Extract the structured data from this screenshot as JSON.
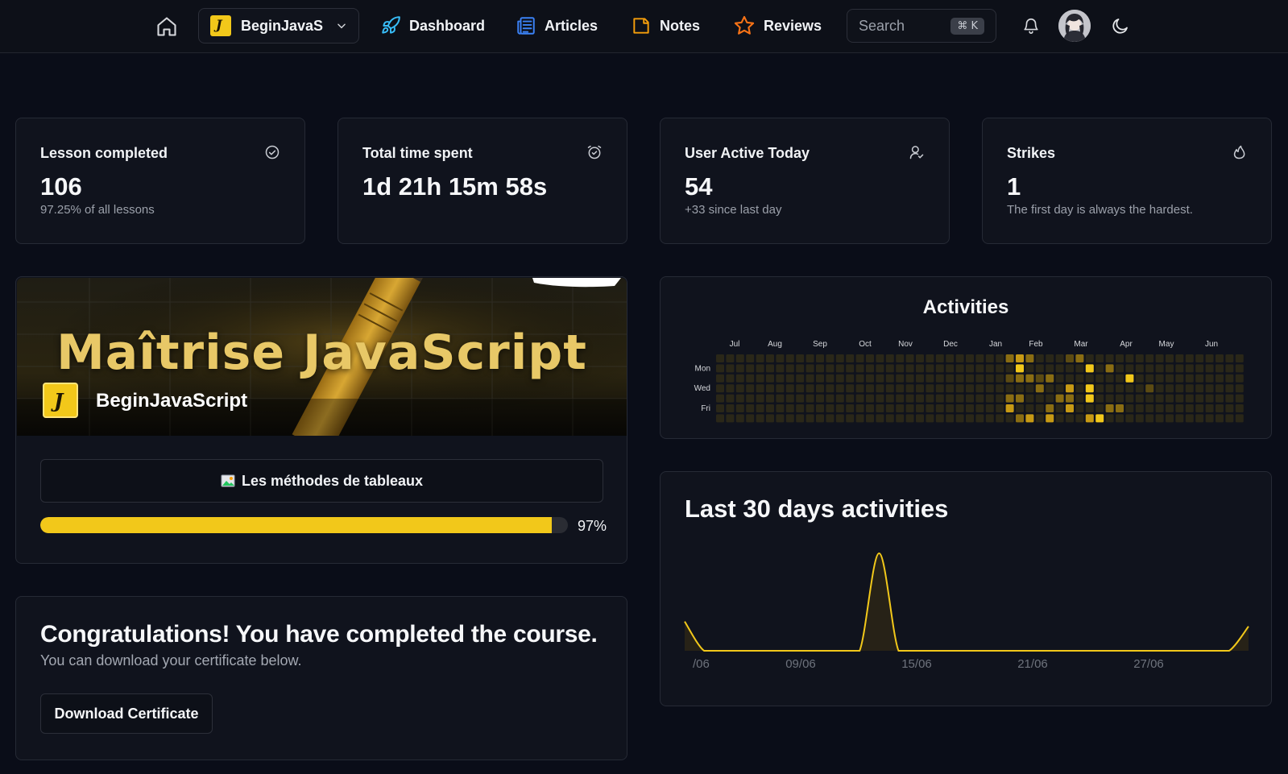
{
  "nav": {
    "course_selector": "BeginJavaS",
    "links": [
      {
        "label": "Dashboard",
        "icon": "rocket-icon",
        "color": "#38bdf8"
      },
      {
        "label": "Articles",
        "icon": "newspaper-icon",
        "color": "#3b82f6"
      },
      {
        "label": "Notes",
        "icon": "sticky-note-icon",
        "color": "#f59e0b"
      },
      {
        "label": "Reviews",
        "icon": "star-icon",
        "color": "#f97316"
      }
    ],
    "search_placeholder": "Search",
    "search_shortcut": "⌘ K"
  },
  "stats": [
    {
      "title": "Lesson completed",
      "value": "106",
      "sub": "97.25% of all lessons",
      "icon": "check-circle-icon"
    },
    {
      "title": "Total time spent",
      "value": "1d 21h 15m 58s",
      "sub": "",
      "icon": "alarm-clock-icon"
    },
    {
      "title": "User Active Today",
      "value": "54",
      "sub": "+33 since last day",
      "icon": "user-icon"
    },
    {
      "title": "Strikes",
      "value": "1",
      "sub": "The first day is always the hardest.",
      "icon": "flame-icon"
    }
  ],
  "course": {
    "banner_title": "Maîtrise JavaScript",
    "banner_name": "BeginJavaScript",
    "current_lesson": "Les méthodes de tableaux",
    "progress": 97,
    "progress_label": "97%"
  },
  "congrats": {
    "title": "Congratulations! You have completed the course.",
    "subtitle": "You can download your certificate below.",
    "button": "Download Certificate"
  },
  "colors": {
    "accent": "#f2c81a",
    "background": "#0a0d18",
    "card": "#10131d",
    "border": "#262a35"
  },
  "activities": {
    "title": "Activities",
    "months": [
      "Jul",
      "Aug",
      "Sep",
      "Oct",
      "Nov",
      "Dec",
      "Jan",
      "Feb",
      "Mar",
      "Apr",
      "May",
      "Jun"
    ],
    "days": [
      "Mon",
      "Wed",
      "Fri"
    ],
    "weeks": 53,
    "active_cells": [
      {
        "week": 29,
        "day": 0,
        "level": 2
      },
      {
        "week": 29,
        "day": 2,
        "level": 1
      },
      {
        "week": 29,
        "day": 4,
        "level": 2
      },
      {
        "week": 29,
        "day": 5,
        "level": 3
      },
      {
        "week": 30,
        "day": 0,
        "level": 3
      },
      {
        "week": 30,
        "day": 1,
        "level": 4
      },
      {
        "week": 30,
        "day": 2,
        "level": 2
      },
      {
        "week": 30,
        "day": 4,
        "level": 2
      },
      {
        "week": 30,
        "day": 6,
        "level": 2
      },
      {
        "week": 31,
        "day": 0,
        "level": 2
      },
      {
        "week": 31,
        "day": 2,
        "level": 2
      },
      {
        "week": 31,
        "day": 6,
        "level": 3
      },
      {
        "week": 32,
        "day": 2,
        "level": 1
      },
      {
        "week": 32,
        "day": 3,
        "level": 2
      },
      {
        "week": 33,
        "day": 2,
        "level": 2
      },
      {
        "week": 33,
        "day": 5,
        "level": 2
      },
      {
        "week": 33,
        "day": 6,
        "level": 3
      },
      {
        "week": 34,
        "day": 4,
        "level": 2
      },
      {
        "week": 35,
        "day": 0,
        "level": 1
      },
      {
        "week": 35,
        "day": 3,
        "level": 3
      },
      {
        "week": 35,
        "day": 4,
        "level": 2
      },
      {
        "week": 35,
        "day": 5,
        "level": 3
      },
      {
        "week": 36,
        "day": 0,
        "level": 2
      },
      {
        "week": 37,
        "day": 1,
        "level": 4
      },
      {
        "week": 37,
        "day": 3,
        "level": 4
      },
      {
        "week": 37,
        "day": 4,
        "level": 4
      },
      {
        "week": 37,
        "day": 6,
        "level": 3
      },
      {
        "week": 38,
        "day": 6,
        "level": 4
      },
      {
        "week": 39,
        "day": 1,
        "level": 2
      },
      {
        "week": 39,
        "day": 5,
        "level": 2
      },
      {
        "week": 40,
        "day": 5,
        "level": 2
      },
      {
        "week": 41,
        "day": 2,
        "level": 4
      },
      {
        "week": 43,
        "day": 3,
        "level": 1
      }
    ]
  },
  "last30": {
    "title": "Last 30 days activities",
    "x_labels": [
      "/06",
      "09/06",
      "15/06",
      "21/06",
      "27/06"
    ]
  },
  "chart_data": {
    "type": "area",
    "title": "Last 30 days activities",
    "x": [
      "03/06",
      "04/06",
      "05/06",
      "06/06",
      "07/06",
      "08/06",
      "09/06",
      "10/06",
      "11/06",
      "12/06",
      "13/06",
      "14/06",
      "15/06",
      "16/06",
      "17/06",
      "18/06",
      "19/06",
      "20/06",
      "21/06",
      "22/06",
      "23/06",
      "24/06",
      "25/06",
      "26/06",
      "27/06",
      "28/06",
      "29/06",
      "30/06",
      "01/07",
      "02/07"
    ],
    "x_tick_labels": [
      "/06",
      "09/06",
      "15/06",
      "21/06",
      "27/06"
    ],
    "series": [
      {
        "values": [
          0.3,
          0,
          0,
          0,
          0,
          0,
          0,
          0,
          0,
          0,
          1,
          0,
          0,
          0,
          0,
          0,
          0,
          0,
          0,
          0,
          0,
          0,
          0,
          0,
          0,
          0,
          0,
          0,
          0,
          0.25
        ]
      }
    ],
    "ylim": [
      0,
      1.05
    ],
    "grid": false,
    "color": "#f2c81a"
  }
}
